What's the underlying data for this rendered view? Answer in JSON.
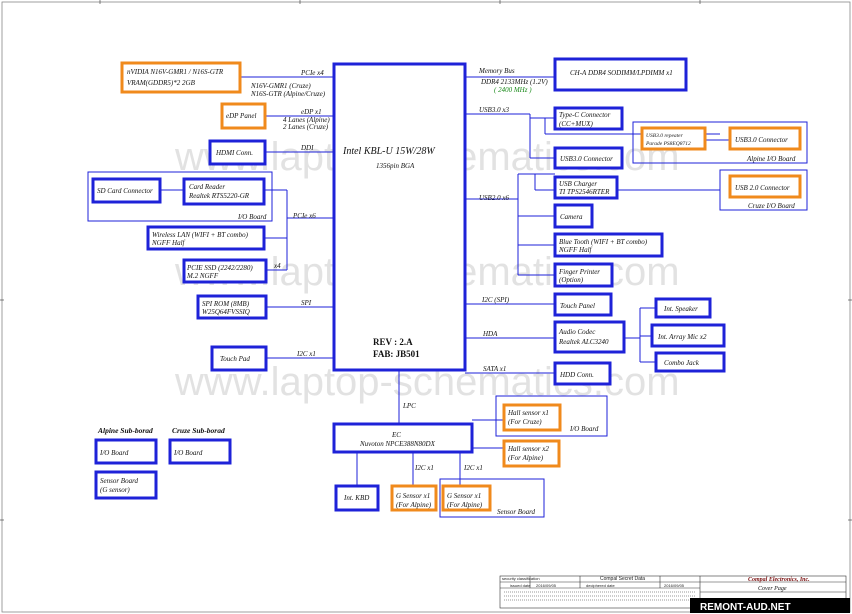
{
  "cpu": {
    "title": "Intel KBL-U  15W/28W",
    "package": "1356pin BGA",
    "rev": "REV : 2.A",
    "fab": "FAB: JB501"
  },
  "gpu": {
    "line1": "nVIDIA  N16V-GMR1 / N16S-GTR",
    "line2": "VRAM(GDDR5)*2 2GB",
    "bus": "PCIe x4",
    "note1": "N16V-GMR1  (Cruze)",
    "note2": "N16S-GTR   (Alpine/Cruze)"
  },
  "edp": {
    "label": "eDP Panel",
    "bus": "eDP x1",
    "note1": "4 Lanes (Alpine)",
    "note2": "2 Lanes (Cruze)"
  },
  "hdmi": {
    "label": "HDMI Conn.",
    "bus": "DDI"
  },
  "io_board_left": {
    "label": "I/O Board",
    "sd": "SD Card Connector",
    "reader1": "Card Reader",
    "reader2": "Realtek  RTS5220-GR",
    "bus": "PCIe x6"
  },
  "wlan": {
    "line1": "Wireless LAN (WIFI + BT combo)",
    "line2": "NGFF Half"
  },
  "ssd": {
    "line1": "PCIE SSD  (2242/2280)",
    "line2": "M.2 NGFF",
    "bus": "x4"
  },
  "spi": {
    "line1": "SPI ROM (8MB)",
    "line2": "W25Q64FVSSIQ",
    "bus": "SPI"
  },
  "touchpad": {
    "label": "Touch Pad",
    "bus": "I2C x1"
  },
  "memory": {
    "label": "CH-A DDR4 SODIMM/LPDIMM x1",
    "bus": "Memory Bus",
    "spec": "DDR4 2133MHz (1.2V)",
    "speed": "( 2400 MHz )"
  },
  "usb3": {
    "bus": "USB3.0 x3",
    "typec1": "Type-C Connector",
    "typec2": "(CC+MUX)",
    "repeater1": "USB3.0  repeater",
    "repeater2": "Parade  PS8EQ8712",
    "conn_alpine": "USB3.0 Connector",
    "alpine_label": "Alpine I/O Board",
    "conn": "USB3.0 Connector"
  },
  "usb2": {
    "bus": "USB2.0 x6",
    "charger1": "USB Charger",
    "charger2": "TI  TPS2546RTER",
    "conn_cruze": "USB 2.0 Connector",
    "cruze_label": "Cruze I/O Board",
    "camera": "Camera",
    "bt1": "Blue Tooth (WIFI + BT combo)",
    "bt2": "NGFF Half",
    "finger1": "Finger Printer",
    "finger2": "(Option)"
  },
  "touch_panel": {
    "label": "Touch Panel",
    "bus": "I2C (SPI)"
  },
  "audio": {
    "line1": "Audio Codec",
    "line2": "Realtek ALC3240",
    "bus": "HDA",
    "speaker": "Int. Speaker",
    "mic": "Int. Array Mic x2",
    "jack": "Combo Jack"
  },
  "hdd": {
    "label": "HDD Conn.",
    "bus": "SATA x1"
  },
  "ec": {
    "line1": "EC",
    "line2": "Nuvoton   NPCE388N80DX",
    "bus": "LPC"
  },
  "hall": {
    "cruze1": "Hall sensor x1",
    "cruze2": "(For Cruze)",
    "io_label": "I/O Board",
    "alpine1": "Hall sensor x2",
    "alpine2": "(For Alpine)"
  },
  "kbd": {
    "label": "Int. KBD"
  },
  "gsensor": {
    "a1": "G Sensor x1",
    "a2": "(For Alpine)",
    "b1": "G Sensor x1",
    "b2": "(For Alpine)",
    "bus_a": "I2C x1",
    "bus_b": "I2C x1",
    "board": "Sensor Board"
  },
  "legend": {
    "alpine_title": "Alpine  Sub-borad",
    "cruze_title": "Cruze  Sub-borad",
    "alpine_io": "I/O Board",
    "cruze_io": "I/O Board",
    "sensor1": "Sensor Board",
    "sensor2": "(G sensor)"
  },
  "titleblock": {
    "company": "Compal Electronics, Inc.",
    "secret": "Compal Secret Data",
    "page": "Cover Page",
    "security": "security classification",
    "issued": "issued date",
    "deciphered": "deciphered date",
    "date1": "2016/09/05",
    "date2": "2016/09/05"
  },
  "watermark": {
    "text": "www.laptop-schematics.com"
  },
  "logo": {
    "text": "REMONT-AUD.NET"
  }
}
